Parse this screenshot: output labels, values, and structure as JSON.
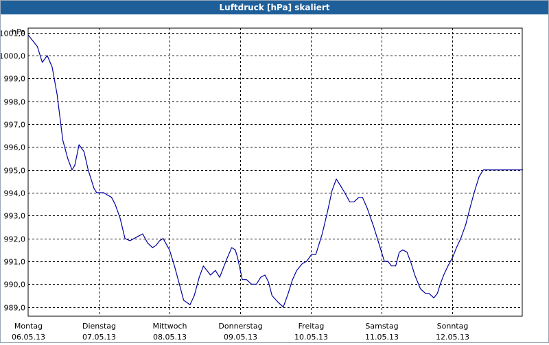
{
  "window": {
    "title": "Luftdruck [hPa] skaliert"
  },
  "chart_data": {
    "type": "line",
    "title": "Luftdruck [hPa] skaliert",
    "ylabel": "hPa",
    "ylim": [
      988.6,
      1001.2
    ],
    "xlim": [
      0,
      7
    ],
    "grid": true,
    "y_ticks": [
      "989,0",
      "990,0",
      "991,0",
      "992,0",
      "993,0",
      "994,0",
      "995,0",
      "996,0",
      "997,0",
      "998,0",
      "999,0",
      "1000,0",
      "1001,0"
    ],
    "x_ticks": [
      {
        "day": "Montag",
        "date": "06.05.13"
      },
      {
        "day": "Dienstag",
        "date": "07.05.13"
      },
      {
        "day": "Mittwoch",
        "date": "08.05.13"
      },
      {
        "day": "Donnerstag",
        "date": "09.05.13"
      },
      {
        "day": "Freitag",
        "date": "10.05.13"
      },
      {
        "day": "Samstag",
        "date": "11.05.13"
      },
      {
        "day": "Sonntag",
        "date": "12.05.13"
      }
    ],
    "series": [
      {
        "color": "#0000a0",
        "x": [
          0.0,
          0.13,
          0.2,
          0.27,
          0.34,
          0.41,
          0.49,
          0.56,
          0.62,
          0.66,
          0.72,
          0.79,
          0.85,
          0.89,
          0.93,
          0.97,
          1.01,
          1.07,
          1.12,
          1.18,
          1.23,
          1.3,
          1.37,
          1.44,
          1.5,
          1.56,
          1.62,
          1.69,
          1.76,
          1.81,
          1.86,
          1.91,
          2.0,
          2.07,
          2.14,
          2.2,
          2.29,
          2.35,
          2.42,
          2.48,
          2.58,
          2.65,
          2.71,
          2.76,
          2.81,
          2.88,
          2.93,
          2.96,
          3.03,
          3.09,
          3.16,
          3.23,
          3.29,
          3.35,
          3.4,
          3.45,
          3.54,
          3.61,
          3.68,
          3.74,
          3.8,
          3.88,
          3.94,
          4.01,
          4.07,
          4.12,
          4.16,
          4.23,
          4.3,
          4.36,
          4.42,
          4.48,
          4.55,
          4.61,
          4.68,
          4.73,
          4.8,
          4.89,
          4.93,
          4.99,
          5.04,
          5.09,
          5.14,
          5.2,
          5.25,
          5.3,
          5.36,
          5.42,
          5.47,
          5.55,
          5.62,
          5.67,
          5.74,
          5.79,
          5.83,
          5.88,
          5.94,
          6.01,
          6.06,
          6.12,
          6.19,
          6.24,
          6.31,
          6.38,
          6.44,
          6.48,
          6.53,
          6.6,
          6.66,
          6.72,
          6.79,
          6.85,
          6.92,
          6.98,
          7.0
        ],
        "y": [
          1000.9,
          1000.4,
          999.7,
          1000.0,
          999.5,
          998.3,
          996.3,
          995.5,
          995.0,
          995.2,
          996.1,
          995.8,
          995.0,
          994.6,
          994.2,
          994.0,
          994.0,
          994.0,
          993.9,
          993.8,
          993.5,
          992.9,
          992.0,
          991.9,
          992.0,
          992.1,
          992.2,
          991.8,
          991.6,
          991.7,
          991.9,
          992.0,
          991.5,
          990.8,
          990.0,
          989.3,
          989.1,
          989.5,
          990.3,
          990.8,
          990.4,
          990.6,
          990.3,
          990.7,
          991.1,
          991.6,
          991.5,
          991.2,
          990.2,
          990.2,
          990.0,
          990.0,
          990.3,
          990.4,
          990.1,
          989.5,
          989.2,
          989.0,
          989.6,
          990.2,
          990.6,
          990.9,
          991.0,
          991.3,
          991.3,
          991.8,
          992.2,
          993.1,
          994.1,
          994.6,
          994.3,
          994.0,
          993.6,
          993.6,
          993.8,
          993.8,
          993.3,
          992.5,
          992.1,
          991.5,
          991.0,
          991.0,
          990.8,
          990.8,
          991.4,
          991.5,
          991.4,
          990.9,
          990.4,
          989.8,
          989.6,
          989.6,
          989.4,
          989.6,
          990.0,
          990.4,
          990.8,
          991.2,
          991.6,
          992.0,
          992.6,
          993.2,
          994.0,
          994.7,
          995.0,
          995.0,
          995.0,
          995.0,
          995.0,
          995.0,
          995.0,
          995.0,
          995.0,
          995.0,
          995.0
        ]
      }
    ]
  }
}
